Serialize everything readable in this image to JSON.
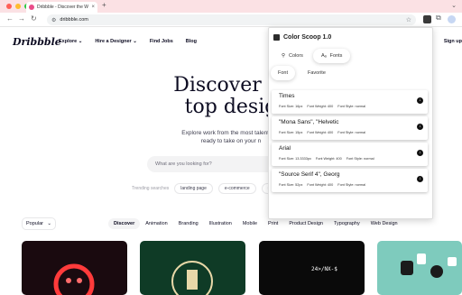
{
  "browser": {
    "tab_title": "Dribbble - Discover the Wor...",
    "tab_close": "×",
    "new_tab": "+",
    "tab_menu": "⌄",
    "url": "dribbble.com",
    "nav_back": "←",
    "nav_forward": "→",
    "nav_reload": "↻"
  },
  "site": {
    "logo": "Dribbble",
    "nav": [
      {
        "label": "Explore ⌄"
      },
      {
        "label": "Hire a Designer ⌄"
      },
      {
        "label": "Find Jobs"
      },
      {
        "label": "Blog"
      }
    ],
    "signup": "Sign up",
    "hero_line1": "Discover th",
    "hero_line2": "top desig",
    "sub_line1": "Explore work from the most talented a",
    "sub_line2": "ready to take on your n",
    "search_placeholder": "What are you looking for?",
    "trending_label": "Trending searches",
    "trending": [
      "landing page",
      "e-commerce",
      "mobi"
    ],
    "popular": "Popular",
    "popular_caret": "⌄",
    "categories": [
      "Discover",
      "Animation",
      "Branding",
      "Illustration",
      "Mobile",
      "Print",
      "Product Design",
      "Typography",
      "Web Design"
    ],
    "active_category": "Discover",
    "shot3_text": "24>/NX-$"
  },
  "popup": {
    "title": "Color Scoop 1.0",
    "modes": [
      {
        "label": "Colors",
        "icon": "search-icon",
        "glyph": "⚲"
      },
      {
        "label": "Fonts",
        "icon": "font-icon",
        "glyph": "Aₐ"
      }
    ],
    "active_mode": "Fonts",
    "subtabs": [
      "Font",
      "Favorite"
    ],
    "active_subtab": "Font",
    "fonts": [
      {
        "name": "Times",
        "size": "Font Size: 16px",
        "weight": "Font Weight: 400",
        "style": "Font Style: normal"
      },
      {
        "name": "\"Mona Sans\", \"Helvetic",
        "size": "Font Size: 15px",
        "weight": "Font Weight: 400",
        "style": "Font Style: normal"
      },
      {
        "name": "Arial",
        "size": "Font Size: 13.3333px",
        "weight": "Font Weight: 400",
        "style": "Font Style: normal"
      },
      {
        "name": "\"Source Serif 4\", Georg",
        "size": "Font Size: 52px",
        "weight": "Font Weight: 400",
        "style": "Font Style: normal"
      }
    ]
  },
  "colors": {
    "tab_bar": "#fbe1e4",
    "dribbble_pink": "#ea4c89",
    "text_primary": "#0d0c22"
  }
}
